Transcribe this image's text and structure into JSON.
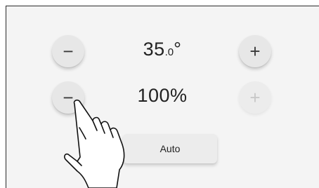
{
  "temperature": {
    "value_main": "35",
    "value_decimal": ".0",
    "unit": "°",
    "decrease_label": "−",
    "increase_label": "+"
  },
  "level": {
    "value": "100%",
    "decrease_label": "−",
    "increase_label": "+",
    "increase_disabled": true
  },
  "mode_button": {
    "label": "Auto"
  },
  "colors": {
    "background": "#f4f4f4",
    "button": "#e7e7e7",
    "text": "#222222",
    "disabled": "#c8c8c8"
  },
  "icons": {
    "pointer": "hand-pointer-icon"
  }
}
